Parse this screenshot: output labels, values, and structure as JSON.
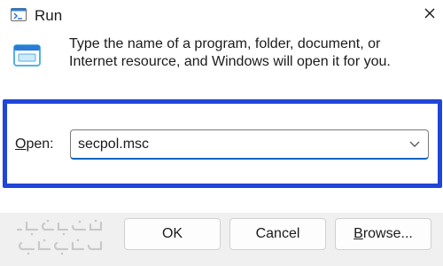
{
  "window": {
    "title": "Run"
  },
  "dialog": {
    "description": "Type the name of a program, folder, document, or Internet resource, and Windows will open it for you.",
    "open_label_accel": "O",
    "open_label_rest": "pen:",
    "open_value": "secpol.msc"
  },
  "buttons": {
    "ok": "OK",
    "cancel": "Cancel",
    "browse_accel": "B",
    "browse_rest": "rowse..."
  },
  "icons": {
    "title": "run-app-icon",
    "dialog": "run-app-icon",
    "close": "close-icon",
    "dropdown": "chevron-down-icon"
  },
  "colors": {
    "highlight": "#1f45d9",
    "icon_accent": "#2b7bd6",
    "focus_underline": "#0067c0"
  },
  "watermark": {
    "text": "البوابة الإلكترونية محافظة القاهرة"
  }
}
